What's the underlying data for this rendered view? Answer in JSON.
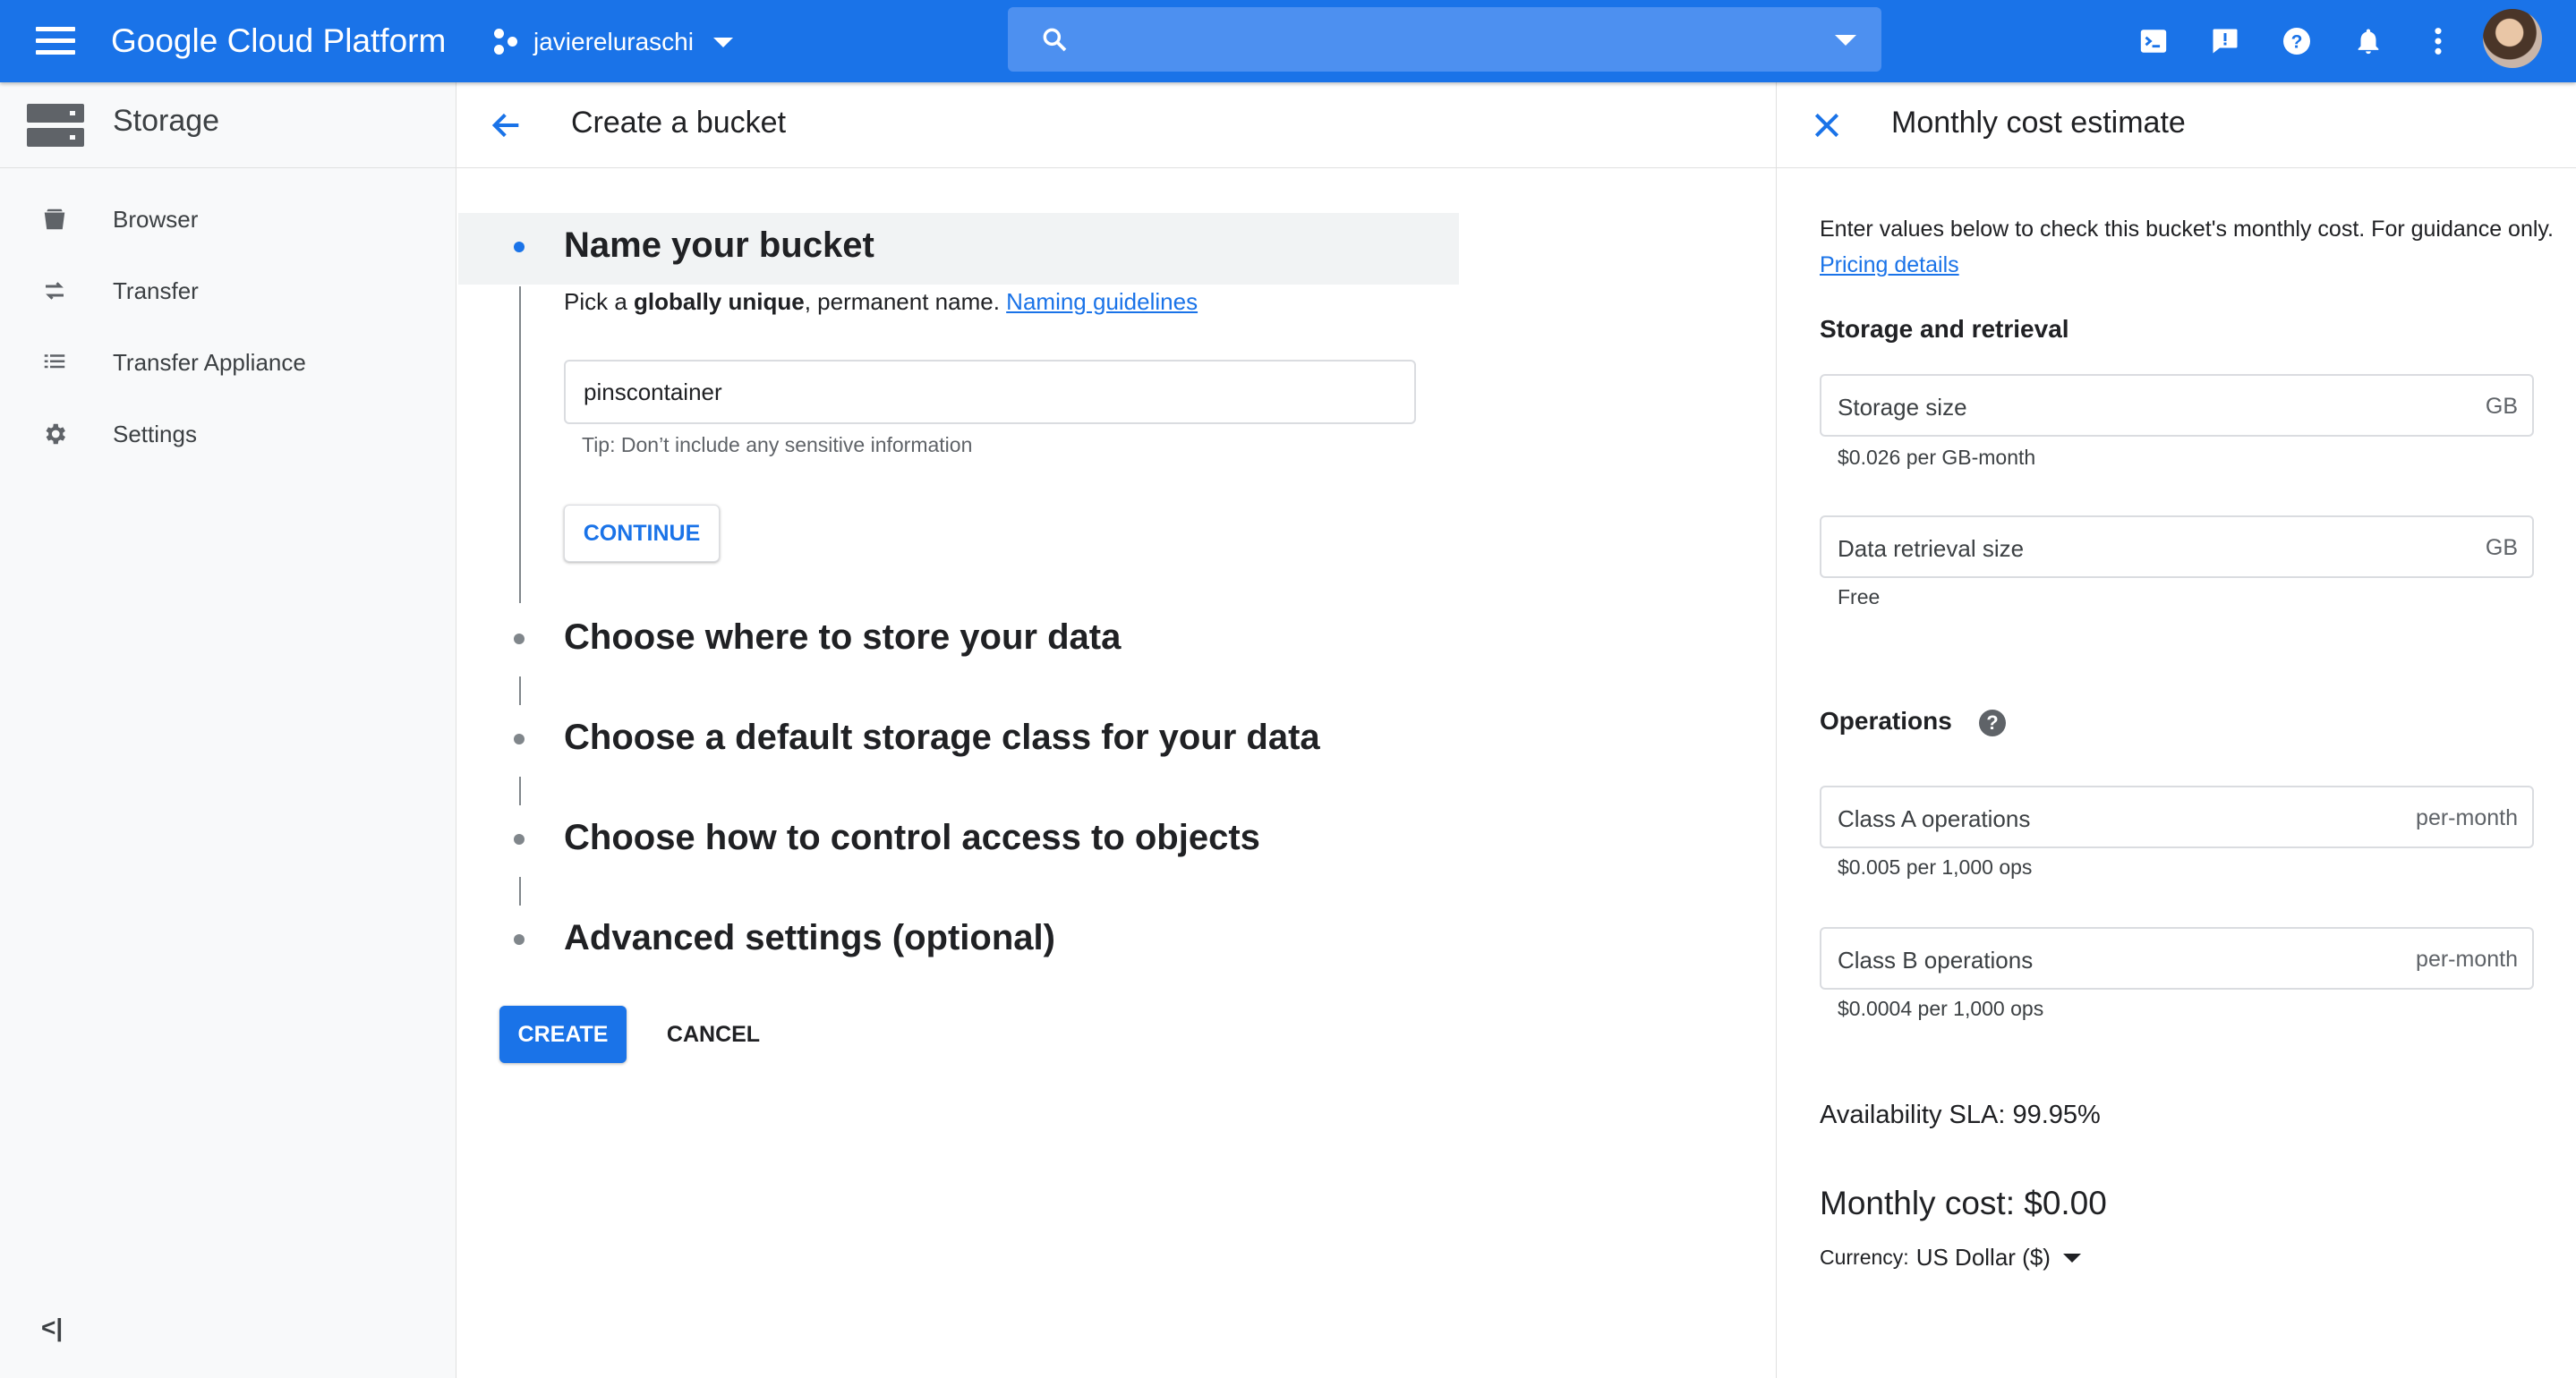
{
  "topbar": {
    "brand": "Google Cloud Platform",
    "project": "javiereluraschi",
    "search_placeholder": "",
    "icons": [
      "menu-icon",
      "project-dots-icon",
      "search-icon",
      "cloud-shell-icon",
      "feedback-icon",
      "help-icon",
      "notifications-icon",
      "more-vert-icon",
      "avatar"
    ],
    "color": "#1a73e8"
  },
  "sidebar": {
    "title": "Storage",
    "items": [
      {
        "label": "Browser",
        "icon": "bucket-icon"
      },
      {
        "label": "Transfer",
        "icon": "transfer-arrows-icon"
      },
      {
        "label": "Transfer Appliance",
        "icon": "list-icon"
      },
      {
        "label": "Settings",
        "icon": "gear-icon"
      }
    ],
    "collapse_label": "<|"
  },
  "main": {
    "title": "Create a bucket",
    "steps": [
      {
        "title": "Name your bucket",
        "active": true
      },
      {
        "title": "Choose where to store your data",
        "active": false
      },
      {
        "title": "Choose a default storage class for your data",
        "active": false
      },
      {
        "title": "Choose how to control access to objects",
        "active": false
      },
      {
        "title": "Advanced settings (optional)",
        "active": false
      }
    ],
    "name_step": {
      "desc_prefix": "Pick a ",
      "desc_bold": "globally unique",
      "desc_suffix": ", permanent name. ",
      "link": "Naming guidelines",
      "input_value": "pinscontainer",
      "tip": "Tip: Don’t include any sensitive information",
      "continue_label": "CONTINUE"
    },
    "create_label": "CREATE",
    "cancel_label": "CANCEL"
  },
  "cost_panel": {
    "title": "Monthly cost estimate",
    "intro": "Enter values below to check this bucket's monthly cost. For guidance only. ",
    "intro_link": "Pricing details",
    "storage_heading": "Storage and retrieval",
    "fields": [
      {
        "label": "Storage size",
        "unit": "GB",
        "hint": "$0.026 per GB-month"
      },
      {
        "label": "Data retrieval size",
        "unit": "GB",
        "hint": "Free"
      },
      {
        "label": "Class A operations",
        "unit": "per-month",
        "hint": "$0.005 per 1,000 ops"
      },
      {
        "label": "Class B operations",
        "unit": "per-month",
        "hint": "$0.0004 per 1,000 ops"
      }
    ],
    "operations_heading": "Operations",
    "sla": "Availability SLA: 99.95%",
    "monthly_cost": "Monthly cost: $0.00",
    "currency_label": "Currency:",
    "currency_value": "US Dollar ($)"
  }
}
